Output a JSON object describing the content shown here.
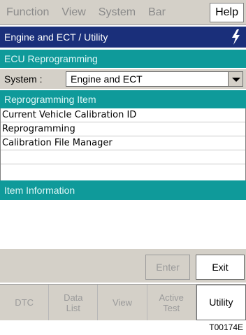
{
  "menubar": {
    "items": [
      {
        "label": "Function",
        "enabled": false
      },
      {
        "label": "View",
        "enabled": false
      },
      {
        "label": "System",
        "enabled": false
      },
      {
        "label": "Bar",
        "enabled": false
      },
      {
        "label": "Help",
        "enabled": true
      }
    ]
  },
  "titlebar": {
    "title": "Engine and ECT / Utility"
  },
  "ecu_header": "ECU Reprogramming",
  "system": {
    "label": "System :",
    "value": "Engine and ECT"
  },
  "reprogramming_header": "Reprogramming Item",
  "reprogramming_items": [
    "Current Vehicle Calibration ID",
    "Reprogramming",
    "Calibration File Manager"
  ],
  "item_information_header": "Item Information",
  "buttons": {
    "enter": "Enter",
    "exit": "Exit"
  },
  "tabs": [
    {
      "label": "DTC",
      "active": false
    },
    {
      "label": "Data\nList",
      "active": false
    },
    {
      "label": "View",
      "active": false
    },
    {
      "label": "Active\nTest",
      "active": false
    },
    {
      "label": "Utility",
      "active": true
    }
  ],
  "figure_code": "T00174E",
  "colors": {
    "title_bar": "#1a2f7a",
    "section_bar": "#0f9a9a",
    "chrome": "#d4d0c8"
  }
}
